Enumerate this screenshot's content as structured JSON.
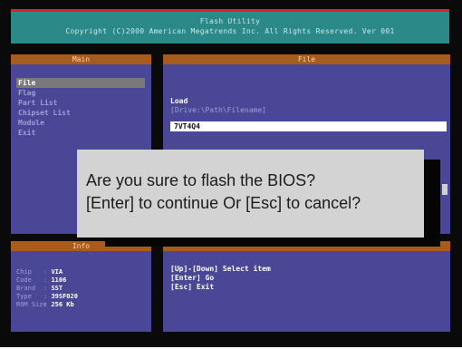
{
  "header": {
    "title": "Flash Utility",
    "copyright": "Copyright (C)2000 American Megatrends Inc. All Rights Reserved. Ver 001"
  },
  "main_panel": {
    "title": "Main",
    "items": [
      {
        "label": "File",
        "selected": true
      },
      {
        "label": "Flag",
        "selected": false
      },
      {
        "label": "Part List",
        "selected": false
      },
      {
        "label": "Chipset List",
        "selected": false
      },
      {
        "label": "Module",
        "selected": false
      },
      {
        "label": "Exit",
        "selected": false
      }
    ]
  },
  "file_panel": {
    "title": "File",
    "load_label": "Load",
    "path_hint": "[Drive:\\Path\\Filename]",
    "filename_value": "7VT4Q4"
  },
  "info_panel": {
    "title": "Info",
    "rows": [
      {
        "key": "Chip",
        "value": "VIA"
      },
      {
        "key": "Code",
        "value": "1106"
      },
      {
        "key": "Brand",
        "value": "SST"
      },
      {
        "key": "Type",
        "value": "39SF020"
      },
      {
        "key": "ROM Size",
        "value": "256 Kb"
      }
    ]
  },
  "help_panel": {
    "title": "",
    "lines": [
      "[Up]-[Down] Select item",
      "[Enter] Go",
      "[Esc] Exit"
    ]
  },
  "dialog": {
    "line1": "Are you sure to flash the BIOS?",
    "line2": "[Enter] to continue Or [Esc] to cancel?"
  },
  "colors": {
    "panel_bg": "#4b4797",
    "panel_header": "#a85c1c",
    "titlebar_bg": "#2b8a88",
    "titlebar_accent": "#e21d25",
    "dialog_bg": "#d3d3d3"
  }
}
